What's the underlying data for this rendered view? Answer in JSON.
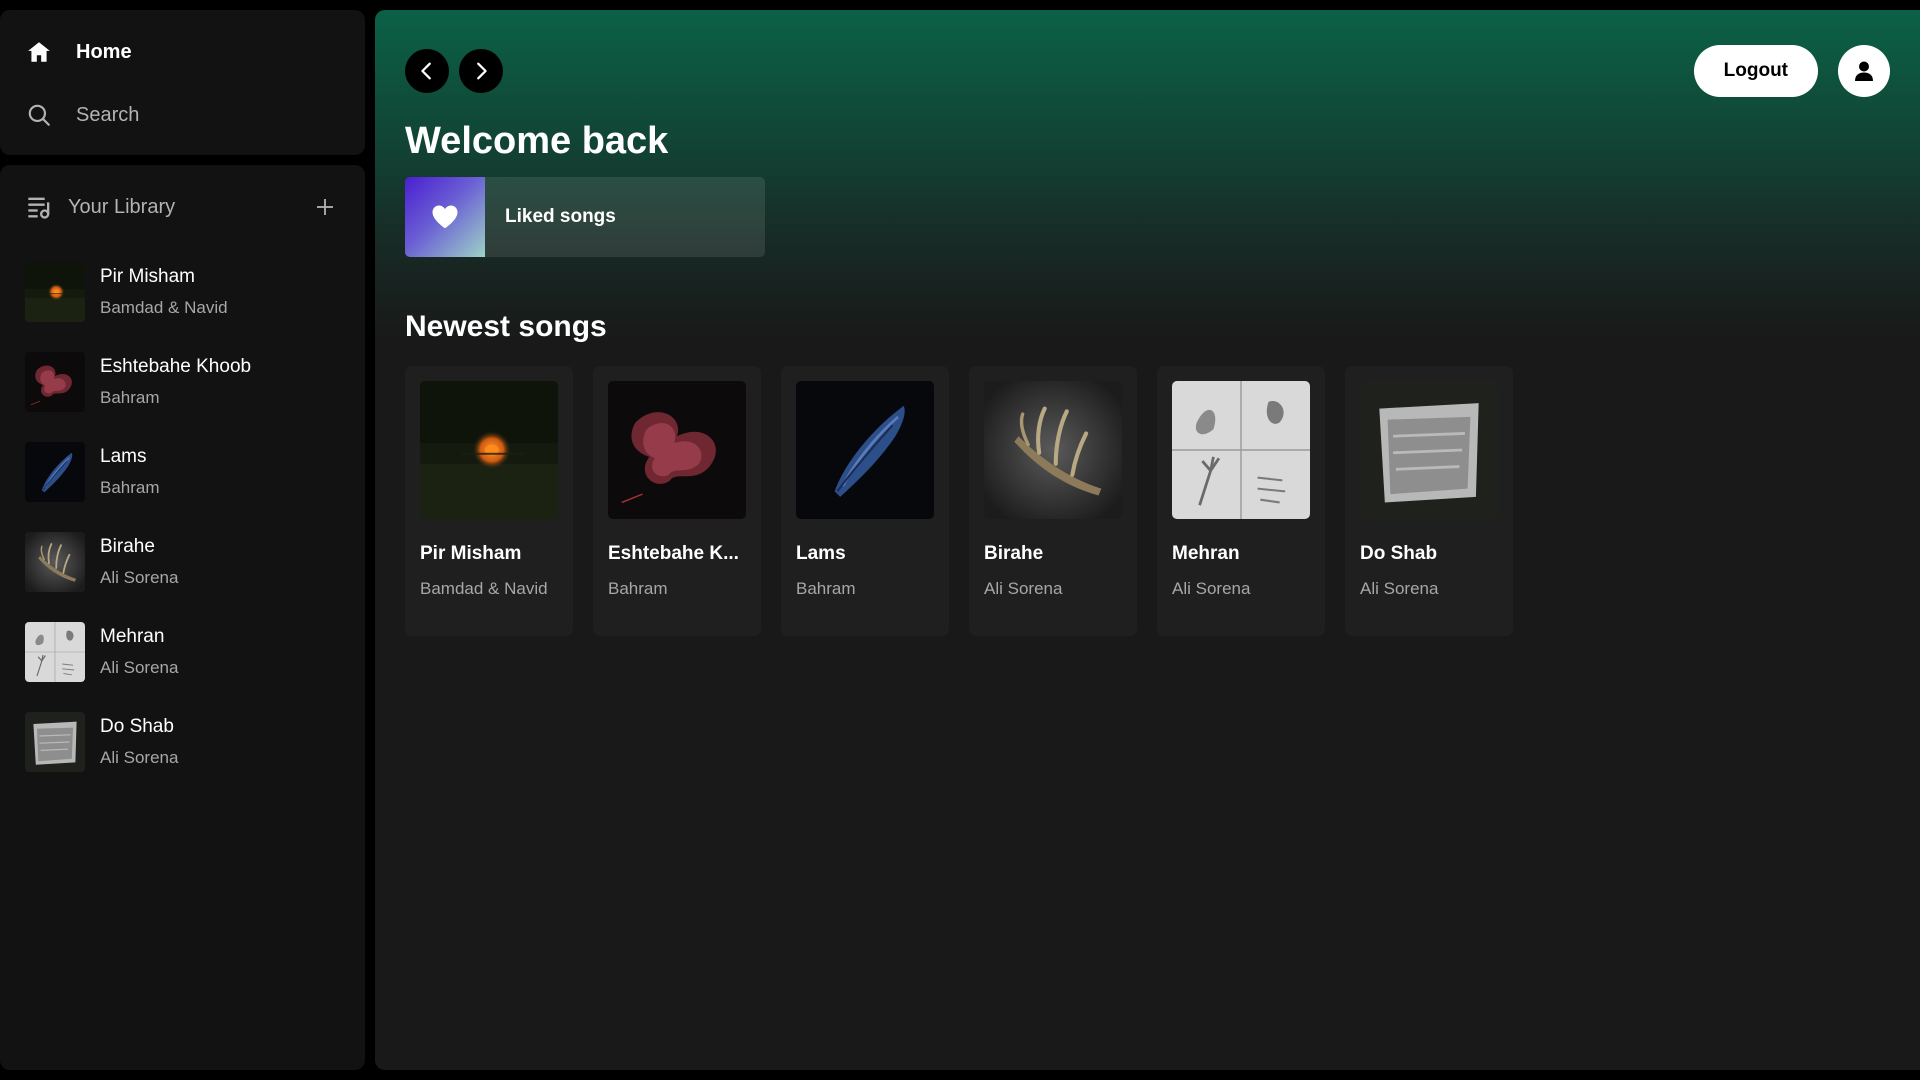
{
  "sidebar": {
    "nav": {
      "home_label": "Home",
      "search_label": "Search"
    },
    "library": {
      "title": "Your Library",
      "items": [
        {
          "title": "Pir Misham",
          "artist": "Bamdad & Navid"
        },
        {
          "title": "Eshtebahe Khoob",
          "artist": "Bahram"
        },
        {
          "title": "Lams",
          "artist": "Bahram"
        },
        {
          "title": "Birahe",
          "artist": "Ali Sorena"
        },
        {
          "title": "Mehran",
          "artist": "Ali Sorena"
        },
        {
          "title": "Do Shab",
          "artist": "Ali Sorena"
        }
      ]
    }
  },
  "header": {
    "logout_label": "Logout"
  },
  "main": {
    "welcome_title": "Welcome back",
    "liked_songs_label": "Liked songs",
    "newest_title": "Newest songs",
    "cards": [
      {
        "title": "Pir Misham",
        "artist": "Bamdad & Navid"
      },
      {
        "title": "Eshtebahe K...",
        "artist": "Bahram"
      },
      {
        "title": "Lams",
        "artist": "Bahram"
      },
      {
        "title": "Birahe",
        "artist": "Ali Sorena"
      },
      {
        "title": "Mehran",
        "artist": "Ali Sorena"
      },
      {
        "title": "Do Shab",
        "artist": "Ali Sorena"
      }
    ]
  },
  "colors": {
    "background": "#000000",
    "panel": "#121212",
    "header_gradient_top": "#0b6147",
    "card": "#1f1f1f",
    "text_muted": "#a7a7a7",
    "liked_gradient_start": "#4a1fd0",
    "liked_gradient_end": "#9dd2c7"
  },
  "icons": {
    "home": "home-icon",
    "search": "search-icon",
    "library": "library-icon",
    "add": "plus-icon",
    "back": "chevron-left-icon",
    "forward": "chevron-right-icon",
    "user": "user-icon",
    "heart": "heart-icon"
  }
}
